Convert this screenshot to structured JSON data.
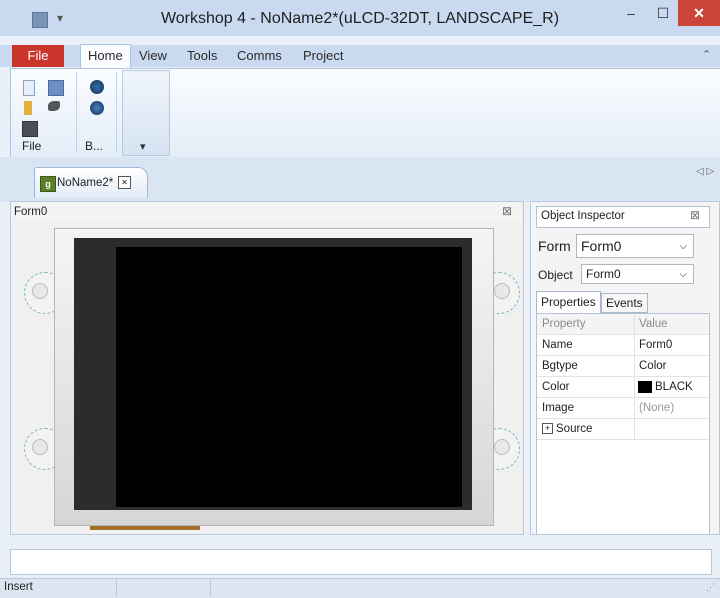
{
  "window": {
    "title": "Workshop 4 - NoName2*(uLCD-32DT, LANDSCAPE_R)",
    "minimize_glyph": "–",
    "maximize_glyph": "☐",
    "close_glyph": "✕"
  },
  "menu": {
    "file": "File",
    "home": "Home",
    "view": "View",
    "tools": "Tools",
    "comms": "Comms",
    "project": "Project",
    "collapse_glyph": "⌃"
  },
  "ribbon": {
    "group_file": "File",
    "group_b": "B...",
    "dropdown_glyph": "▾"
  },
  "doc": {
    "tab_label": "NoName2*",
    "tab_close": "✕",
    "nav_glyphs": "◁ ▷"
  },
  "form": {
    "title": "Form0",
    "close_glyph": "⊠"
  },
  "inspector": {
    "title": "Object Inspector",
    "close_glyph": "⊠",
    "form_label": "Form",
    "form_value": "Form0",
    "object_label": "Object",
    "object_value": "Form0",
    "tab_properties": "Properties",
    "tab_events": "Events",
    "col_property": "Property",
    "col_value": "Value",
    "rows": [
      {
        "property": "Name",
        "value": "Form0"
      },
      {
        "property": "Bgtype",
        "value": "Color"
      },
      {
        "property": "Color",
        "value": "BLACK"
      },
      {
        "property": "Image",
        "value": "(None)"
      },
      {
        "property": "Source",
        "value": ""
      }
    ]
  },
  "status": {
    "text": "Insert"
  },
  "colors": {
    "file_tab": "#c9352b",
    "close_button": "#c9453a",
    "screen": "#000000"
  }
}
